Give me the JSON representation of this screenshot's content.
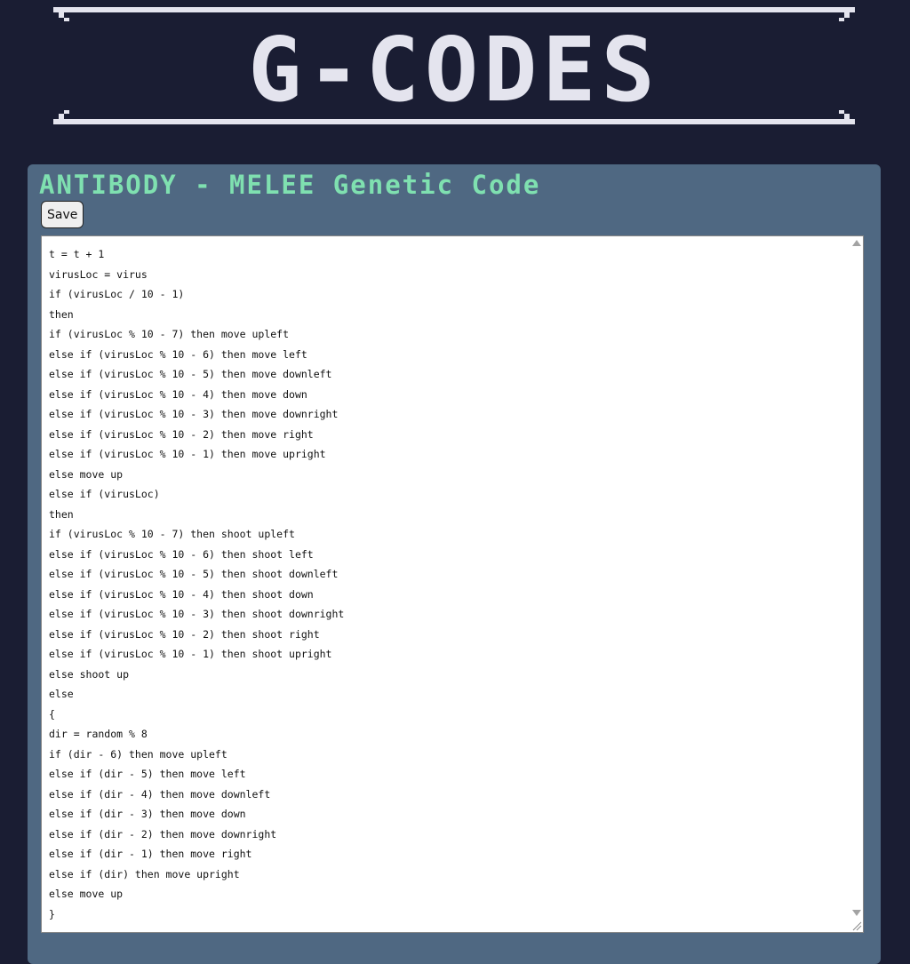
{
  "header": {
    "logo_text": "G-CODES"
  },
  "panel": {
    "title": "ANTIBODY - MELEE Genetic Code",
    "save_label": "Save"
  },
  "editor": {
    "code": "t = t + 1\nvirusLoc = virus\nif (virusLoc / 10 - 1)\nthen\nif (virusLoc % 10 - 7) then move upleft\nelse if (virusLoc % 10 - 6) then move left\nelse if (virusLoc % 10 - 5) then move downleft\nelse if (virusLoc % 10 - 4) then move down\nelse if (virusLoc % 10 - 3) then move downright\nelse if (virusLoc % 10 - 2) then move right\nelse if (virusLoc % 10 - 1) then move upright\nelse move up\nelse if (virusLoc)\nthen\nif (virusLoc % 10 - 7) then shoot upleft\nelse if (virusLoc % 10 - 6) then shoot left\nelse if (virusLoc % 10 - 5) then shoot downleft\nelse if (virusLoc % 10 - 4) then shoot down\nelse if (virusLoc % 10 - 3) then shoot downright\nelse if (virusLoc % 10 - 2) then shoot right\nelse if (virusLoc % 10 - 1) then shoot upright\nelse shoot up\nelse\n{\ndir = random % 8\nif (dir - 6) then move upleft\nelse if (dir - 5) then move left\nelse if (dir - 4) then move downleft\nelse if (dir - 3) then move down\nelse if (dir - 2) then move downright\nelse if (dir - 1) then move right\nelse if (dir) then move upright\nelse move up\n}"
  },
  "colors": {
    "background": "#1a1d33",
    "panel": "#4f6882",
    "title": "#7fe0b0",
    "logo": "#e4e4ee"
  }
}
